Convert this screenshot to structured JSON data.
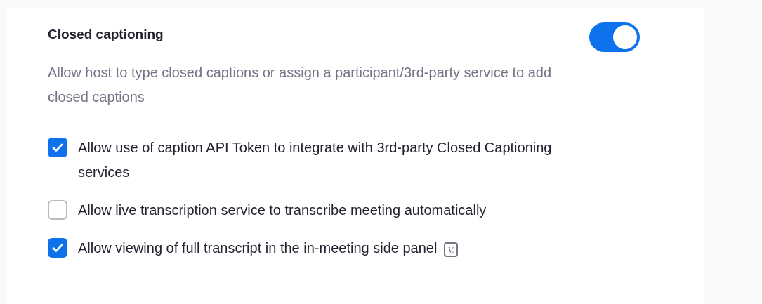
{
  "setting": {
    "title": "Closed captioning",
    "on": true,
    "description": "Allow host to type closed captions or assign a participant/3rd-party service to add closed captions"
  },
  "options": [
    {
      "label": "Allow use of caption API Token to integrate with 3rd-party Closed Captioning services",
      "checked": true
    },
    {
      "label": "Allow live transcription service to transcribe meeting automatically",
      "checked": false
    },
    {
      "label": "Allow viewing of full transcript in the in-meeting side panel",
      "checked": true,
      "badge": "V."
    }
  ]
}
